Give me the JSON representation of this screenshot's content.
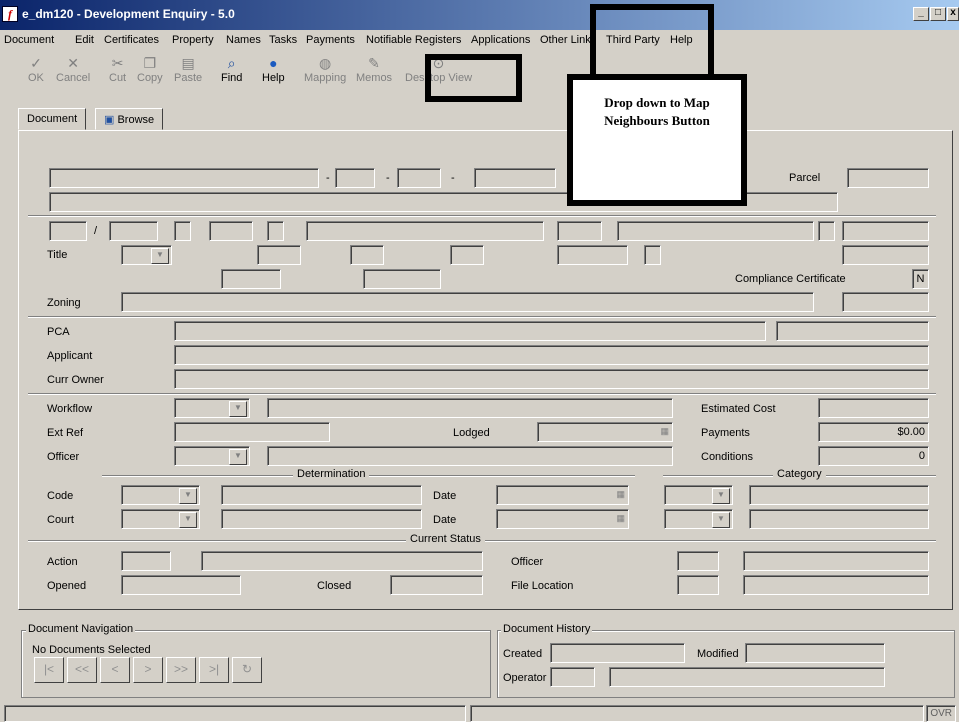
{
  "window": {
    "title": "e_dm120 - Development Enquiry - 5.0",
    "app_icon": "f",
    "min_label": "_",
    "max_label": "□",
    "close_label": "x"
  },
  "menu": [
    "Document",
    "Edit",
    "Certificates",
    "Property",
    "Names",
    "Tasks",
    "Payments",
    "Notifiable Registers",
    "Applications",
    "Other Links",
    "Third Party",
    "Help"
  ],
  "toolbar": {
    "ok": "OK",
    "cancel": "Cancel",
    "cut": "Cut",
    "copy": "Copy",
    "paste": "Paste",
    "find": "Find",
    "help": "Help",
    "mapping": "Mapping",
    "memos": "Memos",
    "desktop_view": "Desktop View"
  },
  "tabs": {
    "document": "Document",
    "browse": "Browse"
  },
  "form": {
    "parcel": "Parcel",
    "title": "Title",
    "compliance_certificate": "Compliance Certificate",
    "compliance_value": "N",
    "zoning": "Zoning",
    "pca": "PCA",
    "applicant": "Applicant",
    "curr_owner": "Curr Owner",
    "workflow": "Workflow",
    "ext_ref": "Ext Ref",
    "officer": "Officer",
    "lodged": "Lodged",
    "estimated_cost": "Estimated Cost",
    "payments": "Payments",
    "payments_value": "$0.00",
    "conditions": "Conditions",
    "conditions_value": "0",
    "determination": "Determination",
    "category": "Category",
    "code": "Code",
    "court": "Court",
    "date": "Date",
    "date2": "Date",
    "current_status": "Current Status",
    "action": "Action",
    "opened": "Opened",
    "closed": "Closed",
    "status_officer": "Officer",
    "file_location": "File Location",
    "dash": "-",
    "slash": "/"
  },
  "nav": {
    "title": "Document Navigation",
    "status": "No Documents Selected",
    "buttons": [
      "|<",
      "<<",
      "<",
      ">",
      ">>",
      ">|",
      "↻"
    ]
  },
  "history": {
    "title": "Document History",
    "created": "Created",
    "modified": "Modified",
    "operator": "Operator"
  },
  "statusbar": {
    "mode": "OVR"
  },
  "annotation": {
    "text": "Drop down to Map Neighbours Button"
  },
  "colors": {
    "title_start": "#0a246a",
    "title_end": "#a6caf0",
    "face": "#d4d0c8"
  }
}
